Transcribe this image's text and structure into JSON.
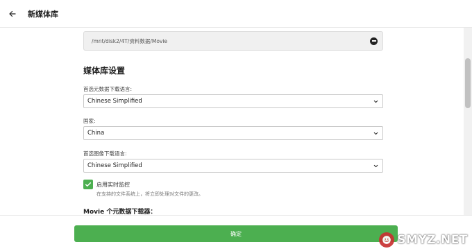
{
  "header": {
    "title": "新媒体库",
    "back_icon": "arrow-left-icon"
  },
  "folder": {
    "path": "/mnt/disk2/4T/资料数据/Movie",
    "remove_icon": "minus-circle-icon"
  },
  "settings": {
    "section_title": "媒体库设置",
    "metadata_language": {
      "label": "首选元数据下载语言:",
      "value": "Chinese Simplified"
    },
    "country": {
      "label": "国家:",
      "value": "China"
    },
    "image_language": {
      "label": "首选图像下载语言:",
      "value": "Chinese Simplified"
    },
    "realtime_monitor": {
      "checked": true,
      "label": "启用实时监控",
      "description": "在支持的文件系统上，将立即处理对文件的更改。"
    },
    "downloaders_title": "Movie 个元数据下载器："
  },
  "footer": {
    "confirm_label": "确定"
  },
  "watermark": {
    "text": "SMYZ.NET"
  },
  "colors": {
    "accent": "#4caf50",
    "path_bg": "#f0f0f0"
  }
}
